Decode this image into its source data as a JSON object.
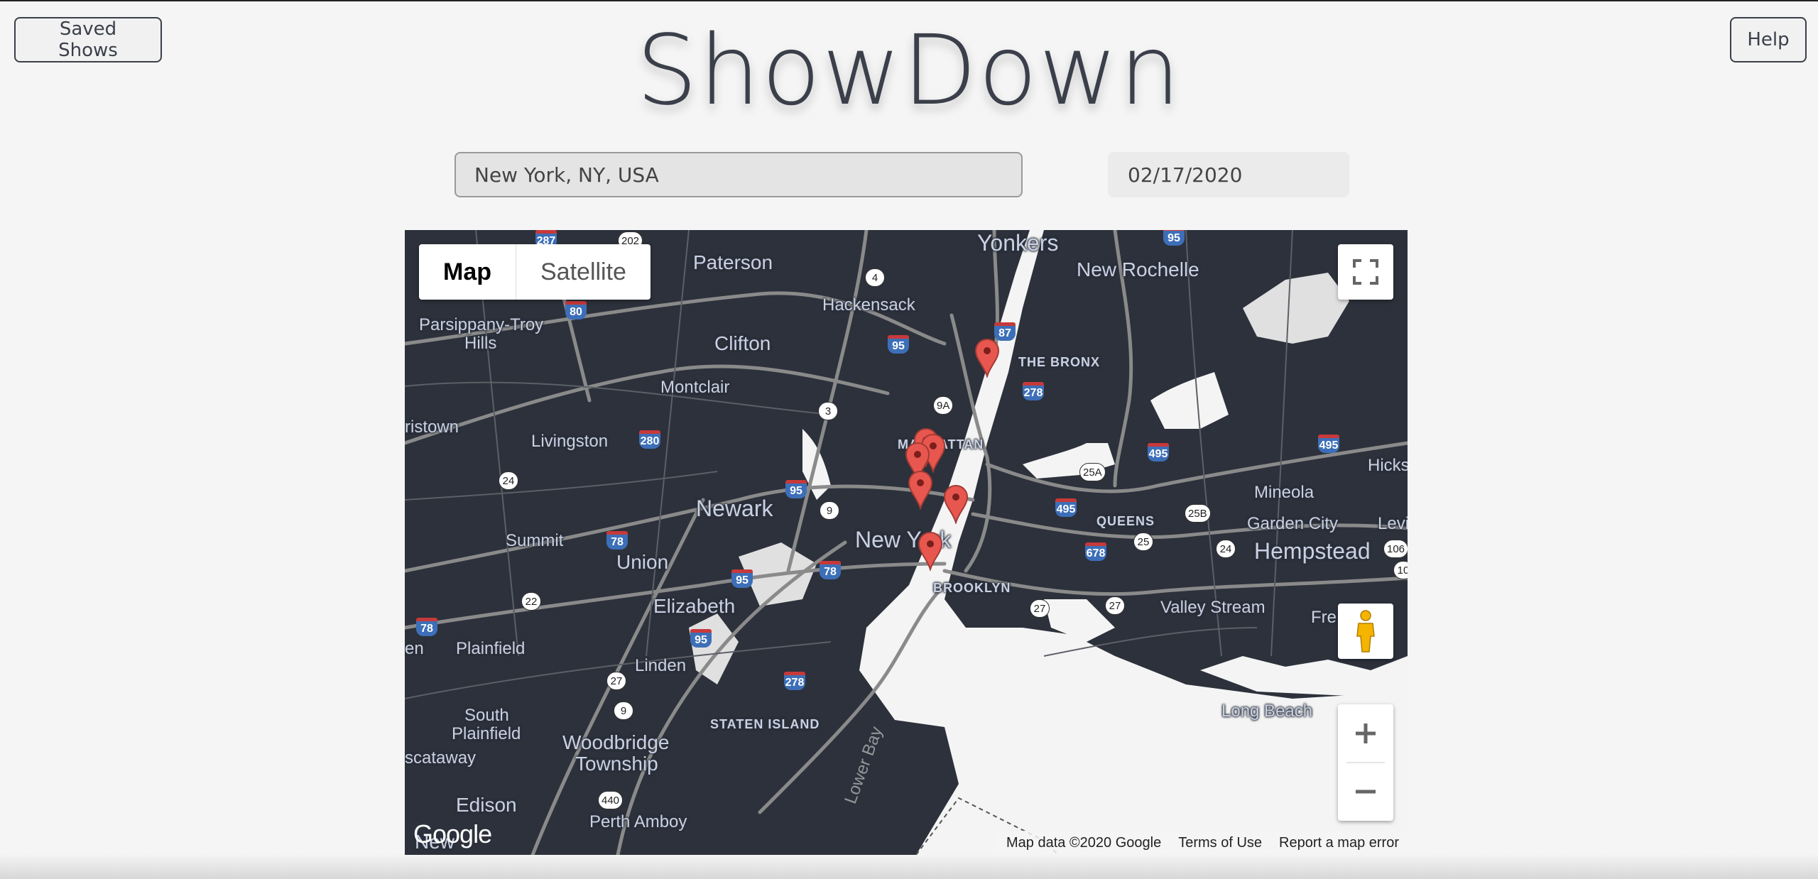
{
  "header": {
    "title": "ShowDown",
    "saved_shows_label": "Saved Shows",
    "help_label": "Help"
  },
  "search": {
    "location_value": "New York, NY, USA",
    "date_value": "02/17/2020"
  },
  "map": {
    "type_map_label": "Map",
    "type_satellite_label": "Satellite",
    "labels": {
      "yonkers": "Yonkers",
      "new_rochelle": "New Rochelle",
      "paterson": "Paterson",
      "hackensack": "Hackensack",
      "parsippany": "Parsippany-Troy",
      "parsippany2": "Hills",
      "clifton": "Clifton",
      "montclair": "Montclair",
      "the_bronx": "THE BRONX",
      "livingston": "Livingston",
      "ristown": "ristown",
      "manhattan": "MANHATTAN",
      "newark": "Newark",
      "new_york": "New York",
      "queens": "QUEENS",
      "mineola": "Mineola",
      "garden_city": "Garden City",
      "hempstead": "Hempstead",
      "hicks": "Hicks",
      "levi": "Levi",
      "summit": "Summit",
      "union": "Union",
      "brooklyn": "BROOKLYN",
      "elizabeth": "Elizabeth",
      "valley_stream": "Valley Stream",
      "fre": "Fre",
      "plainfield": "Plainfield",
      "en": "en",
      "linden": "Linden",
      "south_plainfield": "South",
      "south_plainfield2": "Plainfield",
      "staten_island": "STATEN ISLAND",
      "long_beach": "Long Beach",
      "woodbridge": "Woodbridge",
      "township": "Township",
      "scataway": "scataway",
      "edison": "Edison",
      "perth_amboy": "Perth Amboy",
      "new": "New",
      "lower_bay": "Lower Bay"
    },
    "highways": [
      "287",
      "202",
      "95",
      "87",
      "80",
      "95",
      "278",
      "280",
      "495",
      "95",
      "495",
      "78",
      "78",
      "95",
      "678",
      "78",
      "95",
      "278"
    ],
    "routes": [
      "4",
      "9A",
      "3",
      "25A",
      "24",
      "9",
      "25B",
      "24",
      "106",
      "10",
      "22",
      "27",
      "27",
      "25",
      "27",
      "9",
      "440"
    ],
    "attribution": {
      "data": "Map data ©2020 Google",
      "terms": "Terms of Use",
      "report": "Report a map error"
    },
    "google_logo": "Google",
    "pin_color": "#e8574f"
  },
  "colors": {
    "map_bg": "#2c313b",
    "water": "#ffffff",
    "road": "#8a8a8a"
  }
}
